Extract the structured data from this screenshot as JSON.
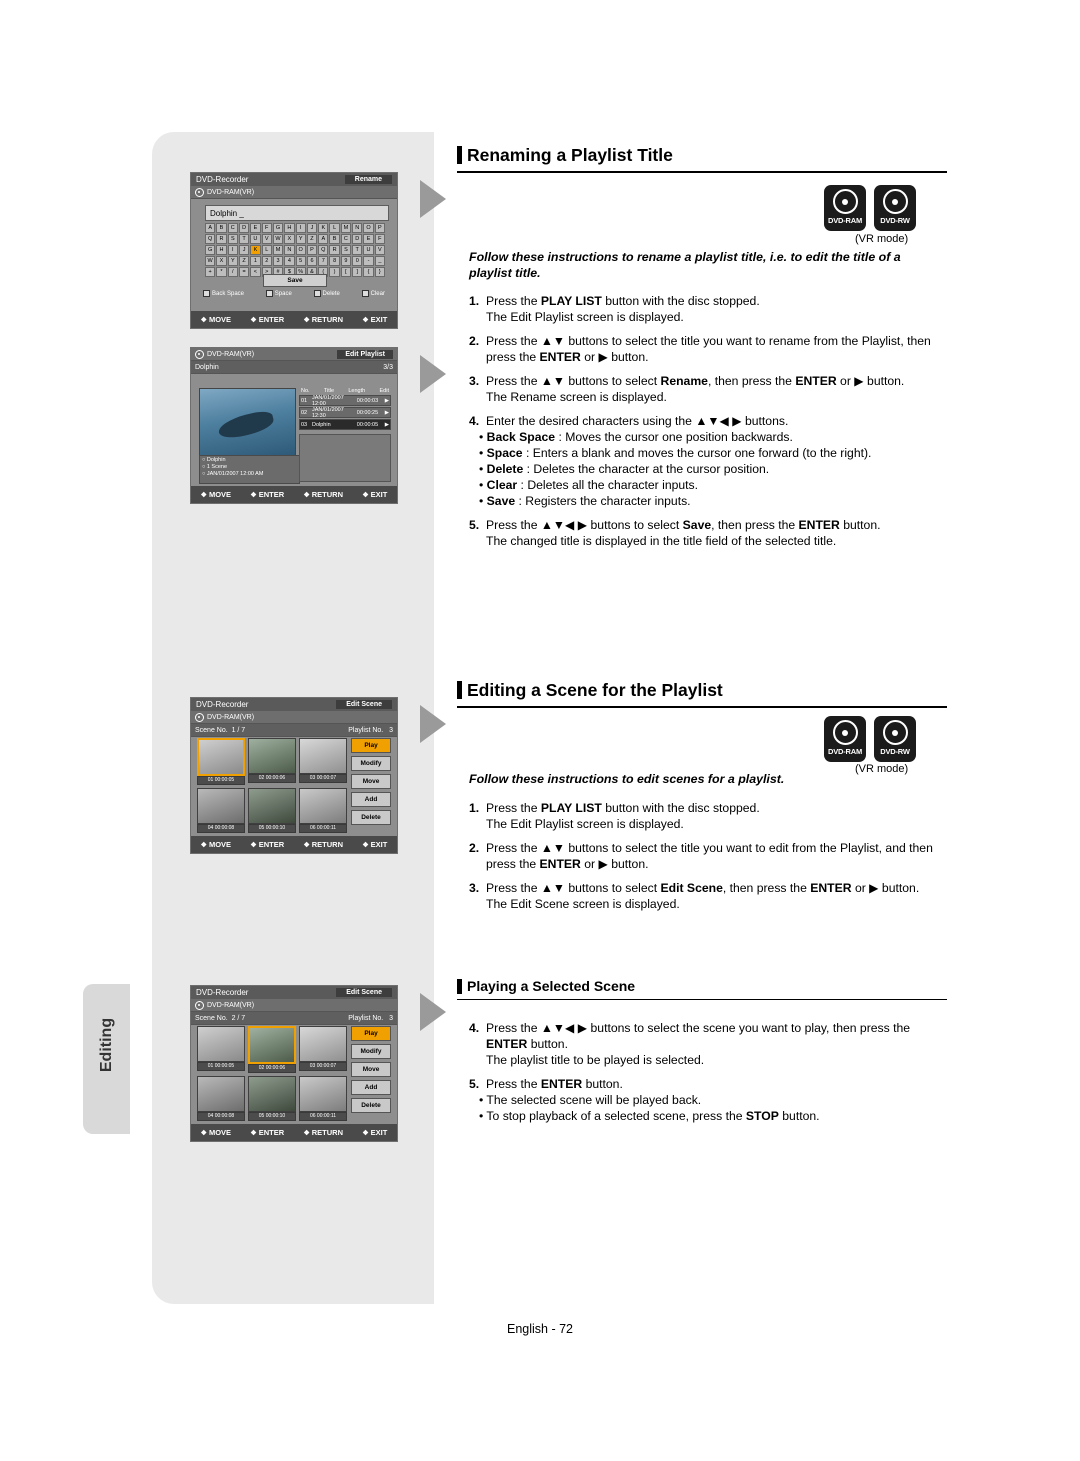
{
  "page": {
    "footer": "English - 72",
    "side_tab": "Editing"
  },
  "sections": [
    {
      "title": "Renaming a Playlist Title",
      "mode_note": "(VR mode)",
      "intro": "Follow these instructions to rename a playlist title, i.e. to edit the title of a playlist title.",
      "steps": [
        {
          "n": "1.",
          "html": "Press the <b>PLAY LIST</b> button with the disc stopped.",
          "cont": [
            "The Edit Playlist screen is displayed."
          ]
        },
        {
          "n": "2.",
          "html": "Press the ▲▼ buttons to select the title you want to rename from the Playlist, then press the <b>ENTER</b> or ▶ button.",
          "cont": []
        },
        {
          "n": "3.",
          "html": "Press the ▲▼ buttons to select <b>Rename</b>, then press the <b>ENTER</b> or ▶ button.",
          "cont": [
            "The Rename screen is displayed."
          ]
        },
        {
          "n": "4.",
          "html": "Enter the desired characters using the ▲▼◀ ▶ buttons.",
          "cont": []
        },
        {
          "n": "5.",
          "html": "Press the ▲▼◀ ▶ buttons to select <b>Save</b>, then press the <b>ENTER</b> button.",
          "cont": [
            "The changed title is displayed in the title field of the selected title."
          ]
        }
      ],
      "bullets": [
        "<b>Back Space</b> : Moves the cursor one position backwards.",
        "<b>Space</b> : Enters a blank and moves the cursor one forward (to the right).",
        "<b>Delete</b> : Deletes the character at the cursor position.",
        "<b>Clear</b> : Deletes all the character inputs.",
        "<b>Save</b> : Registers the character inputs."
      ]
    },
    {
      "title": "Editing a Scene for the Playlist",
      "mode_note": "(VR mode)",
      "intro": "Follow these instructions to edit scenes for a playlist.",
      "steps": [
        {
          "n": "1.",
          "html": "Press the <b>PLAY LIST</b> button with the disc stopped.",
          "cont": [
            "The Edit Playlist screen is displayed."
          ]
        },
        {
          "n": "2.",
          "html": "Press the ▲▼ buttons to select the title you want to edit from the Playlist, and then press the <b>ENTER</b> or ▶ button.",
          "cont": []
        },
        {
          "n": "3.",
          "html": "Press the ▲▼ buttons to select <b>Edit Scene</b>, then press the <b>ENTER</b> or ▶ button.",
          "cont": [
            "The Edit Scene screen is displayed."
          ]
        }
      ]
    },
    {
      "title": "Playing a Selected Scene",
      "steps": [
        {
          "n": "4.",
          "html": "Press the ▲▼◀ ▶ buttons to select the scene you want to play, then press the <b>ENTER</b> button.",
          "cont": [
            "The playlist title to be played is selected."
          ]
        },
        {
          "n": "5.",
          "html": "Press the <b>ENTER</b> button.",
          "cont": []
        }
      ],
      "bullets": [
        "The selected scene will be played back.",
        "To stop playback of a selected scene, press the <b>STOP</b> button."
      ]
    }
  ],
  "disc_logos": [
    {
      "name": "DVD-RAM"
    },
    {
      "name": "DVD-RW"
    }
  ],
  "osd_rename": {
    "brand": "DVD-Recorder",
    "screen": "Rename",
    "disc": "DVD-RAM(VR)",
    "field_value": "Dolphin _",
    "keyboard_rows": [
      [
        "A",
        "B",
        "C",
        "D",
        "E",
        "F",
        "G",
        "H",
        "I",
        "J",
        "K",
        "L",
        "M",
        "N",
        "O",
        "P"
      ],
      [
        "Q",
        "R",
        "S",
        "T",
        "U",
        "V",
        "W",
        "X",
        "Y",
        "Z",
        "A",
        "B",
        "C",
        "D",
        "E",
        "F"
      ],
      [
        "G",
        "H",
        "I",
        "J",
        "K",
        "L",
        "M",
        "N",
        "O",
        "P",
        "Q",
        "R",
        "S",
        "T",
        "U",
        "V"
      ],
      [
        "W",
        "X",
        "Y",
        "Z",
        "1",
        "2",
        "3",
        "4",
        "5",
        "6",
        "7",
        "8",
        "9",
        "0",
        "-",
        "_"
      ],
      [
        "+",
        "*",
        "/",
        "=",
        "<",
        ">",
        "#",
        "$",
        "%",
        "&",
        "(",
        ")",
        "[",
        "]",
        "{",
        "}"
      ]
    ],
    "selected_key": {
      "row": 2,
      "col": 4
    },
    "save_label": "Save",
    "legend": [
      "Back Space",
      "Space",
      "Delete",
      "Clear"
    ],
    "bottom_bar": [
      "MOVE",
      "ENTER",
      "RETURN",
      "EXIT"
    ]
  },
  "osd_editplaylist": {
    "brand": "",
    "screen": "Edit Playlist",
    "disc": "DVD-RAM(VR)",
    "playlist_name": "Dolphin",
    "page_count": "3/3",
    "columns": [
      "No.",
      "Title",
      "Length",
      "Edit"
    ],
    "rows": [
      {
        "no": "01",
        "title": "JAN/01/2007  12:00",
        "len": "00:00:03"
      },
      {
        "no": "02",
        "title": "JAN/01/2007  12:30",
        "len": "00:00:25"
      },
      {
        "no": "03",
        "title": "Dolphin",
        "len": "00:00:05",
        "selected": true
      }
    ],
    "info": [
      "Dolphin",
      "1 Scene",
      "JAN/01/2007 12:00 AM"
    ],
    "bottom_bar": [
      "MOVE",
      "ENTER",
      "RETURN",
      "EXIT"
    ]
  },
  "osd_scene1": {
    "brand": "DVD-Recorder",
    "screen": "Edit Scene",
    "disc": "DVD-RAM(VR)",
    "scene_no_label": "Scene No.",
    "scene_no_value": "1 / 7",
    "playlist_no_label": "Playlist No.",
    "playlist_no_value": "3",
    "cells": [
      {
        "no": "01",
        "time": "00:00:05",
        "selected": true
      },
      {
        "no": "02",
        "time": "00:00:06"
      },
      {
        "no": "03",
        "time": "00:00:07"
      },
      {
        "no": "04",
        "time": "00:00:08"
      },
      {
        "no": "05",
        "time": "00:00:10"
      },
      {
        "no": "06",
        "time": "00:00:11"
      }
    ],
    "buttons": [
      "Play",
      "Modify",
      "Move",
      "Add",
      "Delete"
    ],
    "selected_button": "Play",
    "bottom_bar": [
      "MOVE",
      "ENTER",
      "RETURN",
      "EXIT"
    ]
  },
  "osd_scene2": {
    "brand": "DVD-Recorder",
    "screen": "Edit Scene",
    "disc": "DVD-RAM(VR)",
    "scene_no_label": "Scene No.",
    "scene_no_value": "2 / 7",
    "playlist_no_label": "Playlist No.",
    "playlist_no_value": "3",
    "cells": [
      {
        "no": "01",
        "time": "00:00:05"
      },
      {
        "no": "02",
        "time": "00:00:06",
        "selected": true
      },
      {
        "no": "03",
        "time": "00:00:07"
      },
      {
        "no": "04",
        "time": "00:00:08"
      },
      {
        "no": "05",
        "time": "00:00:10"
      },
      {
        "no": "06",
        "time": "00:00:11"
      }
    ],
    "buttons": [
      "Play",
      "Modify",
      "Move",
      "Add",
      "Delete"
    ],
    "selected_button": "Play",
    "bottom_bar": [
      "MOVE",
      "ENTER",
      "RETURN",
      "EXIT"
    ]
  }
}
